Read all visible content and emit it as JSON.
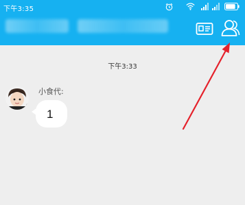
{
  "status_bar": {
    "time": "下午3:35",
    "battery_level": 0.85
  },
  "header": {
    "title_obscured": true,
    "card_icon": "id-card-icon",
    "contacts_icon": "contacts-person-icon"
  },
  "chat": {
    "timestamp": "下午3:33",
    "messages": [
      {
        "sender": "小食代:",
        "text": "1"
      }
    ]
  },
  "colors": {
    "header": "#16b1f1",
    "background": "#eeeeee",
    "annotation_arrow": "#e5212b"
  }
}
